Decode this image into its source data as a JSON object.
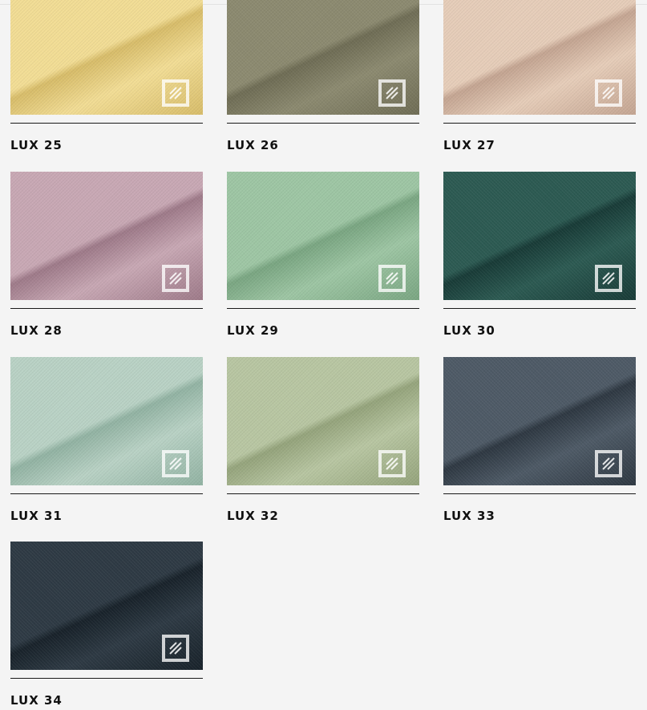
{
  "swatches": [
    {
      "name": "LUX 25",
      "color_light": "#f2dd95",
      "color_dark": "#d8bd6a",
      "texture": "plain"
    },
    {
      "name": "LUX 26",
      "color_light": "#8c8a70",
      "color_dark": "#6f6d55",
      "texture": "plain"
    },
    {
      "name": "LUX 27",
      "color_light": "#e6cdb9",
      "color_dark": "#c4a592",
      "texture": "plain"
    },
    {
      "name": "LUX 28",
      "color_light": "#c8a8b4",
      "color_dark": "#9e7a89",
      "texture": "plain"
    },
    {
      "name": "LUX 29",
      "color_light": "#9ec6a4",
      "color_dark": "#7aa682",
      "texture": "plain"
    },
    {
      "name": "LUX 30",
      "color_light": "#2c5a52",
      "color_dark": "#183b37",
      "texture": "plain"
    },
    {
      "name": "LUX 31",
      "color_light": "#b9d2c5",
      "color_dark": "#92b3a3",
      "texture": "plain"
    },
    {
      "name": "LUX 32",
      "color_light": "#b8c6a2",
      "color_dark": "#95a47c",
      "texture": "plain"
    },
    {
      "name": "LUX 33",
      "color_light": "#4e5a66",
      "color_dark": "#2e3842",
      "texture": "plain"
    },
    {
      "name": "LUX 34",
      "color_light": "#2e3a44",
      "color_dark": "#18222a",
      "texture": "plain"
    }
  ],
  "icons": {
    "badge": "pattern-tile-icon"
  }
}
